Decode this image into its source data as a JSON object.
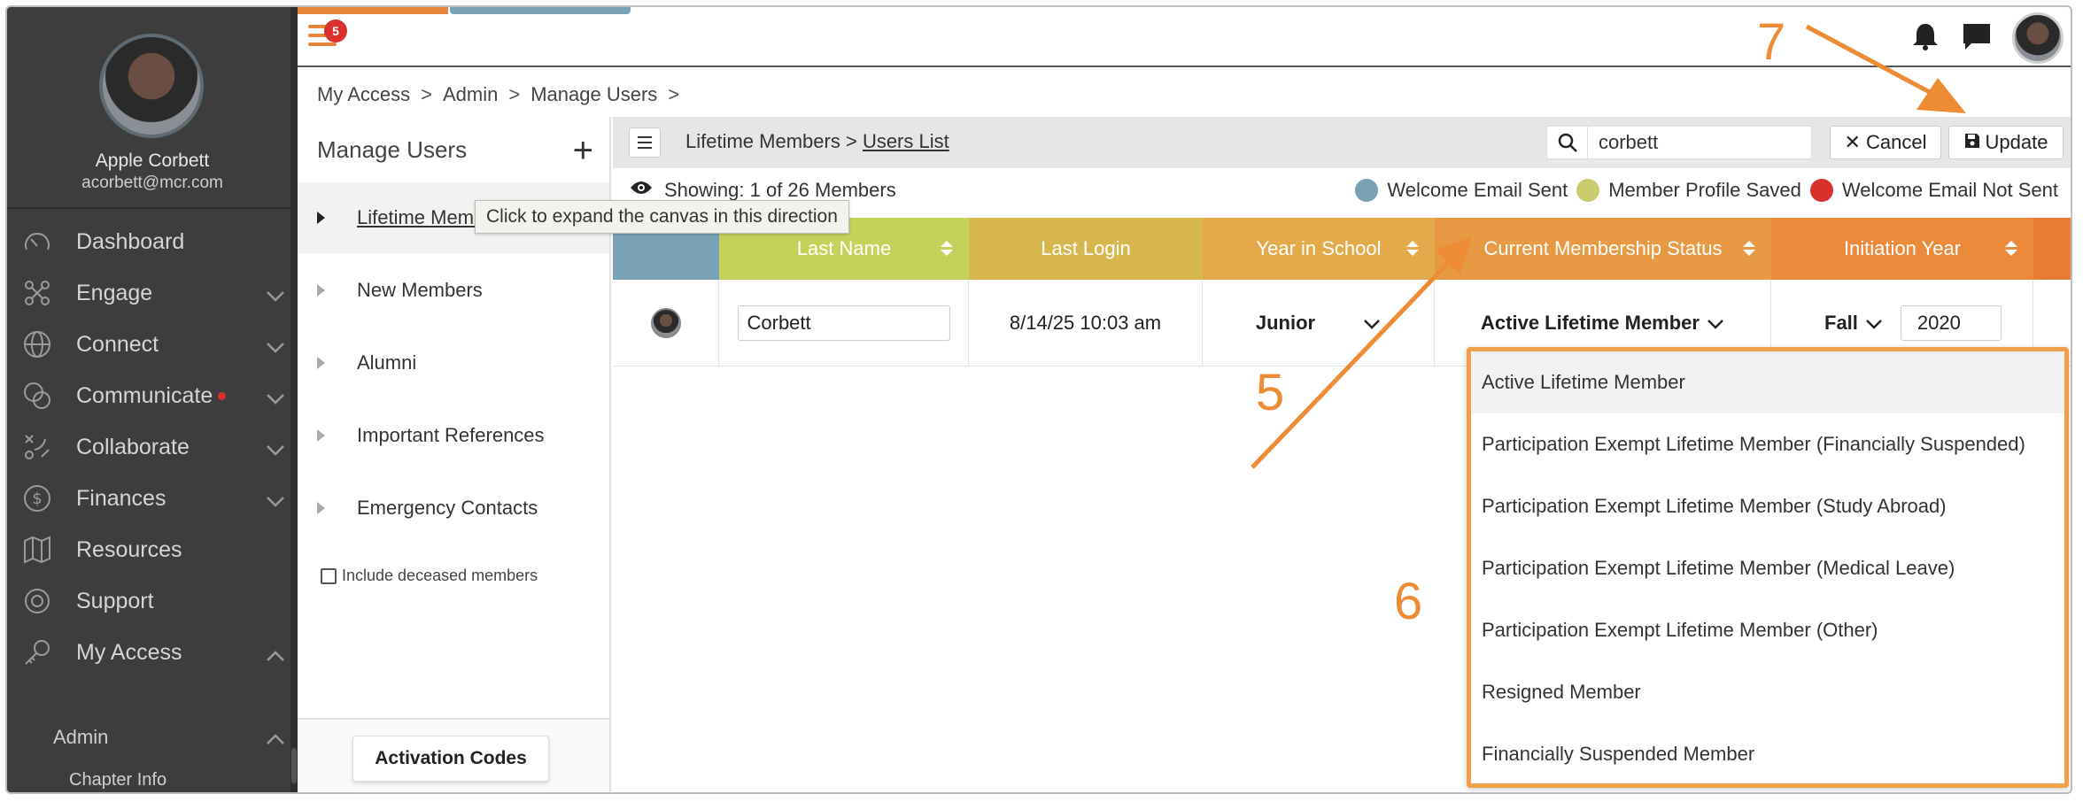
{
  "user": {
    "name": "Apple Corbett",
    "email": "acorbett@mcr.com"
  },
  "nav": {
    "items": [
      {
        "label": "Dashboard",
        "icon": "gauge-icon",
        "chevron": ""
      },
      {
        "label": "Engage",
        "icon": "nodes-icon",
        "chevron": "down"
      },
      {
        "label": "Connect",
        "icon": "globe-icon",
        "chevron": "down"
      },
      {
        "label": "Communicate",
        "icon": "chat-bubbles-icon",
        "chevron": "down",
        "dot": true
      },
      {
        "label": "Collaborate",
        "icon": "strategy-icon",
        "chevron": "down"
      },
      {
        "label": "Finances",
        "icon": "dollar-icon",
        "chevron": "down"
      },
      {
        "label": "Resources",
        "icon": "map-icon",
        "chevron": ""
      },
      {
        "label": "Support",
        "icon": "lifebuoy-icon",
        "chevron": ""
      },
      {
        "label": "My Access",
        "icon": "key-icon",
        "chevron": "up"
      }
    ],
    "sub": [
      {
        "label": "Admin"
      },
      {
        "label": "Chapter Info"
      }
    ]
  },
  "header": {
    "notification_count": "5"
  },
  "breadcrumb": [
    "My Access",
    "Admin",
    "Manage Users"
  ],
  "manage_users": {
    "title": "Manage Users",
    "groups": [
      {
        "label": "Lifetime Members"
      },
      {
        "label": "New Members"
      },
      {
        "label": "Alumni"
      },
      {
        "label": "Important References"
      },
      {
        "label": "Emergency Contacts"
      }
    ],
    "include_deceased_label": "Include deceased members",
    "activation_codes_label": "Activation Codes",
    "tooltip": "Click to expand the canvas in this direction"
  },
  "toolbar": {
    "crumb_group": "Lifetime Members",
    "crumb_page": "Users List",
    "search_value": "corbett",
    "cancel_label": "Cancel",
    "update_label": "Update"
  },
  "showing": "Showing: 1 of 26 Members",
  "legend": [
    {
      "label": "Welcome Email Sent",
      "color": "#7aa2b7"
    },
    {
      "label": "Member Profile Saved",
      "color": "#c8cc6f"
    },
    {
      "label": "Welcome Email Not Sent",
      "color": "#d9302c"
    }
  ],
  "table": {
    "columns": [
      {
        "label": ""
      },
      {
        "label": "Last Name",
        "color": "#c4d15a"
      },
      {
        "label": "Last Login",
        "color": "#d8b64e"
      },
      {
        "label": "Year in School",
        "color": "#e3a94a"
      },
      {
        "label": "Current Membership Status",
        "color": "#e79a43"
      },
      {
        "label": "Initiation Year",
        "color": "#ec8a3b"
      }
    ],
    "row": {
      "last_name": "Corbett",
      "last_login": "8/14/25 10:03 am",
      "year_in_school": "Junior",
      "membership_status": "Active Lifetime Member",
      "initiation_term": "Fall",
      "initiation_year": "2020"
    }
  },
  "status_options": [
    "Active Lifetime Member",
    "Participation Exempt Lifetime Member (Financially Suspended)",
    "Participation Exempt Lifetime Member (Study Abroad)",
    "Participation Exempt Lifetime Member (Medical Leave)",
    "Participation Exempt Lifetime Member (Other)",
    "Resigned Member",
    "Financially Suspended Member"
  ],
  "annotations": {
    "n5": "5",
    "n6": "6",
    "n7": "7"
  },
  "colors": {
    "accent": "#ee8c35",
    "nav_bg": "#3d3d3d"
  }
}
